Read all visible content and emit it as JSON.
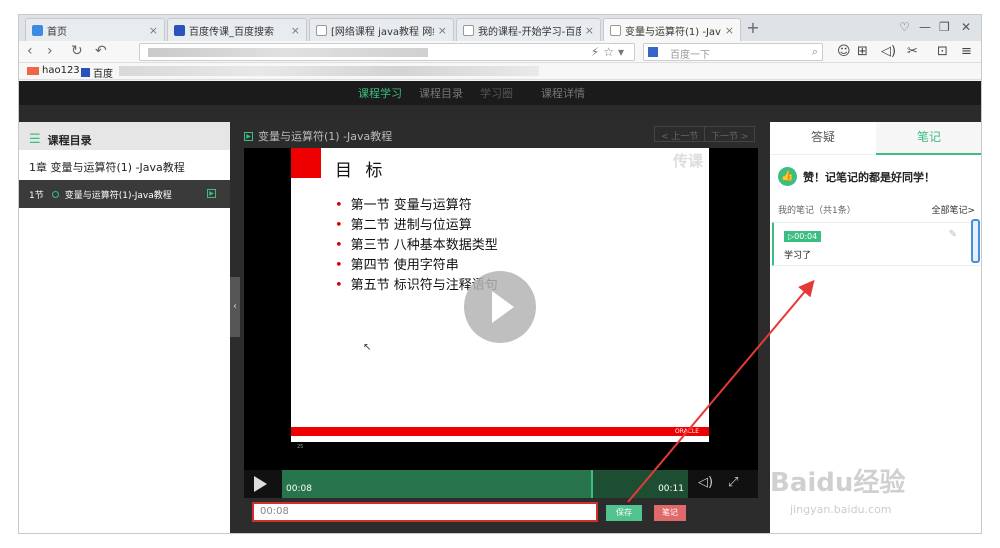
{
  "tabs": [
    {
      "label": "首页",
      "color": "#3c8be0"
    },
    {
      "label": "百度传课_百度搜索",
      "color": "#2a52be"
    },
    {
      "label": "[网络课程 java教程 网络..."
    },
    {
      "label": "我的课程-开始学习-百度..."
    },
    {
      "label": "变量与运算符(1) -Java教...",
      "active": true
    }
  ],
  "address": {
    "search_placeholder": "百度一下"
  },
  "bookmarks": [
    {
      "label": "hao123"
    },
    {
      "label": "百度"
    }
  ],
  "site_nav": [
    "课程学习",
    "课程目录",
    "学习圈",
    "课程详情"
  ],
  "sidebar": {
    "title": "课程目录",
    "chapter": "1章  变量与运算符(1) -Java教程",
    "lesson_num": "1节",
    "lesson_title": "变量与运算符(1)-Java教程"
  },
  "content": {
    "title": "变量与运算符(1) -Java教程",
    "prev": "< 上一节",
    "next": "下一节 >"
  },
  "slide": {
    "title": "目 标",
    "watermark": "传课",
    "bullets": [
      "第一节  变量与运算符",
      "第二节  进制与位运算",
      "第三节  八种基本数据类型",
      "第四节  使用字符串",
      "第五节  标识符与注释语句"
    ],
    "brand": "ORACLE",
    "footer": "25"
  },
  "player": {
    "current_time": "00:08",
    "total_time": "00:11",
    "progress": 0.76
  },
  "note_input": {
    "value": "00:08"
  },
  "buttons": {
    "save": "保存",
    "note": "笔记"
  },
  "right_panel": {
    "tabs": [
      "答疑",
      "笔记"
    ],
    "praise": "赞！记笔记的都是好同学！",
    "my_notes": "我的笔记（共1条）",
    "all_notes": "全部笔记>",
    "note": {
      "time": "▷00:04",
      "text": "学习了"
    }
  },
  "watermark": {
    "brand": "Baidu经验",
    "url": "jingyan.baidu.com"
  },
  "colors": {
    "accent": "#3cbd82",
    "highlight": "#cf2f2f"
  }
}
